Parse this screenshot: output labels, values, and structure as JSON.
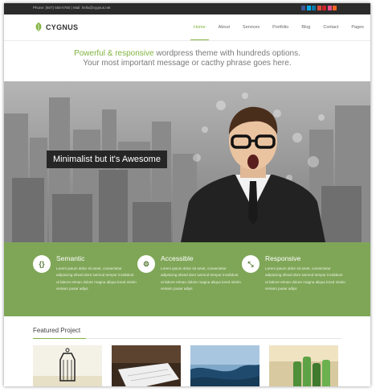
{
  "topbar": {
    "contact_text": "Phone: (607) 555-0780  |  Mail: hello@cygnus.net",
    "social_icons": [
      "facebook-icon",
      "twitter-icon",
      "linkedin-icon",
      "google-plus-icon",
      "pinterest-icon",
      "dribbble-icon",
      "rss-icon"
    ],
    "social_colors": [
      "#3b5998",
      "#00aced",
      "#0e76a8",
      "#dd4b39",
      "#cb2027",
      "#ea4c89",
      "#f26522"
    ]
  },
  "header": {
    "logo_text": "CYGNUS",
    "nav": [
      "Home",
      "About",
      "Services",
      "Portfolio",
      "Blog",
      "Contact",
      "Pages"
    ],
    "active_nav": "Home"
  },
  "tagline": {
    "accent": "Powerful & responsive",
    "line1_rest": " wordpress theme with hundreds options.",
    "line2": "Your most important message or cacthy phrase goes here."
  },
  "hero": {
    "caption": "Minimalist but it's Awesome"
  },
  "features": [
    {
      "title": "Semantic",
      "icon": "code-icon",
      "glyph": "{}",
      "body": "Lorem ipsum dolor sit amet, consectetur adipiscing elised dore iusmod tempor incididunt ut labore etman dolore magna aliqua lored minim veniam pusar adiys"
    },
    {
      "title": "Accessible",
      "icon": "gear-icon",
      "glyph": "⚙",
      "body": "Lorem ipsum dolor sit amet, consectetur adipiscing elised dore iusmod tempor incididunt ut labore etman dolore magna aliqua lored minim veniam pusar adiys"
    },
    {
      "title": "Responsive",
      "icon": "resize-icon",
      "glyph": "⤡",
      "body": "Lorem ipsum dolor sit amet, consectetur adipiscing elised dore iusmod tempor incididunt ut labore etman dolore magna aliqua lored minim veniam pusar adiys"
    }
  ],
  "featured": {
    "title": "Featured Project"
  },
  "colors": {
    "accent": "#82b440",
    "features_bg": "#7fa657",
    "topbar_bg": "#2b2b2b"
  }
}
